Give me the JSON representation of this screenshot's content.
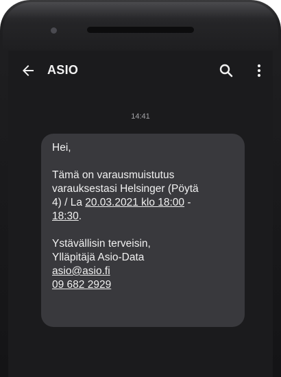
{
  "app_bar": {
    "title": "ASIO",
    "icons": [
      "arrow-back-icon",
      "search-icon",
      "more-vert-icon"
    ]
  },
  "conversation": {
    "timestamp": "14:41",
    "message": {
      "greeting": "Hei,",
      "line1": "Tämä on varausmuistutus",
      "line2": "varauksestasi Helsinger (Pöytä",
      "line3_prefix": "4) / La ",
      "datetime_link": "20.03.2021 klo 18:00",
      "line3_suffix": " -",
      "end_time_link": "18:30",
      "end_time_suffix": ".",
      "closing": "Ystävällisin terveisin,",
      "signature": "Ylläpitäjä Asio-Data",
      "email_link": "asio@asio.fi",
      "phone_link": "09 682 2929"
    }
  },
  "colors": {
    "screen_bg": "#1b1b1d",
    "bubble_bg": "#39393d",
    "text": "#f1f1f1",
    "timestamp": "#a4a4a8"
  }
}
